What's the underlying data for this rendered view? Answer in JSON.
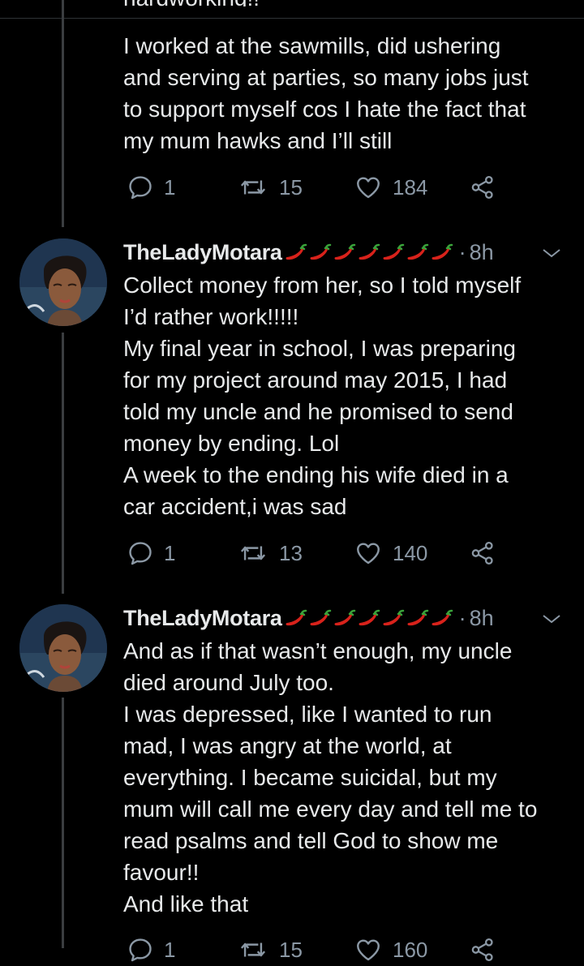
{
  "tweets": [
    {
      "partial_text": "hardworking!!",
      "text": "I worked at the sawmills, did ushering\nand serving at parties, so many jobs just\nto support myself cos I hate the fact that\nmy mum hawks and I’ll still",
      "replies": "1",
      "retweets": "15",
      "likes": "184"
    },
    {
      "author": "TheLadyMotara",
      "emoji": "🌶️🌶️🌶️🌶️🌶️🌶️🌶️",
      "separator": "·",
      "time": "8h",
      "text": "Collect money from her, so I told myself\nI’d rather work!!!!!\nMy final year in school, I was preparing\nfor my project around may 2015, I had\ntold my uncle and he promised to send\nmoney by ending. Lol\nA week to the ending his wife died in a\ncar accident,i was sad",
      "replies": "1",
      "retweets": "13",
      "likes": "140"
    },
    {
      "author": "TheLadyMotara",
      "emoji": "🌶️🌶️🌶️🌶️🌶️🌶️🌶️",
      "separator": "·",
      "time": "8h",
      "text": "And as if that wasn’t enough, my uncle\ndied around July too.\nI was depressed, like I wanted to run\nmad, I was angry at the world, at\neverything. I became suicidal, but my\nmum will call me every day and tell me to\nread psalms and tell God to show me\nfavour!!\nAnd like that",
      "replies": "1",
      "retweets": "15",
      "likes": "160"
    }
  ],
  "colors": {
    "background": "#000000",
    "text": "#e7e9ea",
    "muted": "#8b98a5",
    "thread_line": "#3a3d40",
    "chili": "#d8221b"
  },
  "icons": {
    "reply": "reply-icon",
    "retweet": "retweet-icon",
    "like": "heart-icon",
    "share": "share-icon",
    "caret": "chevron-down-icon"
  }
}
